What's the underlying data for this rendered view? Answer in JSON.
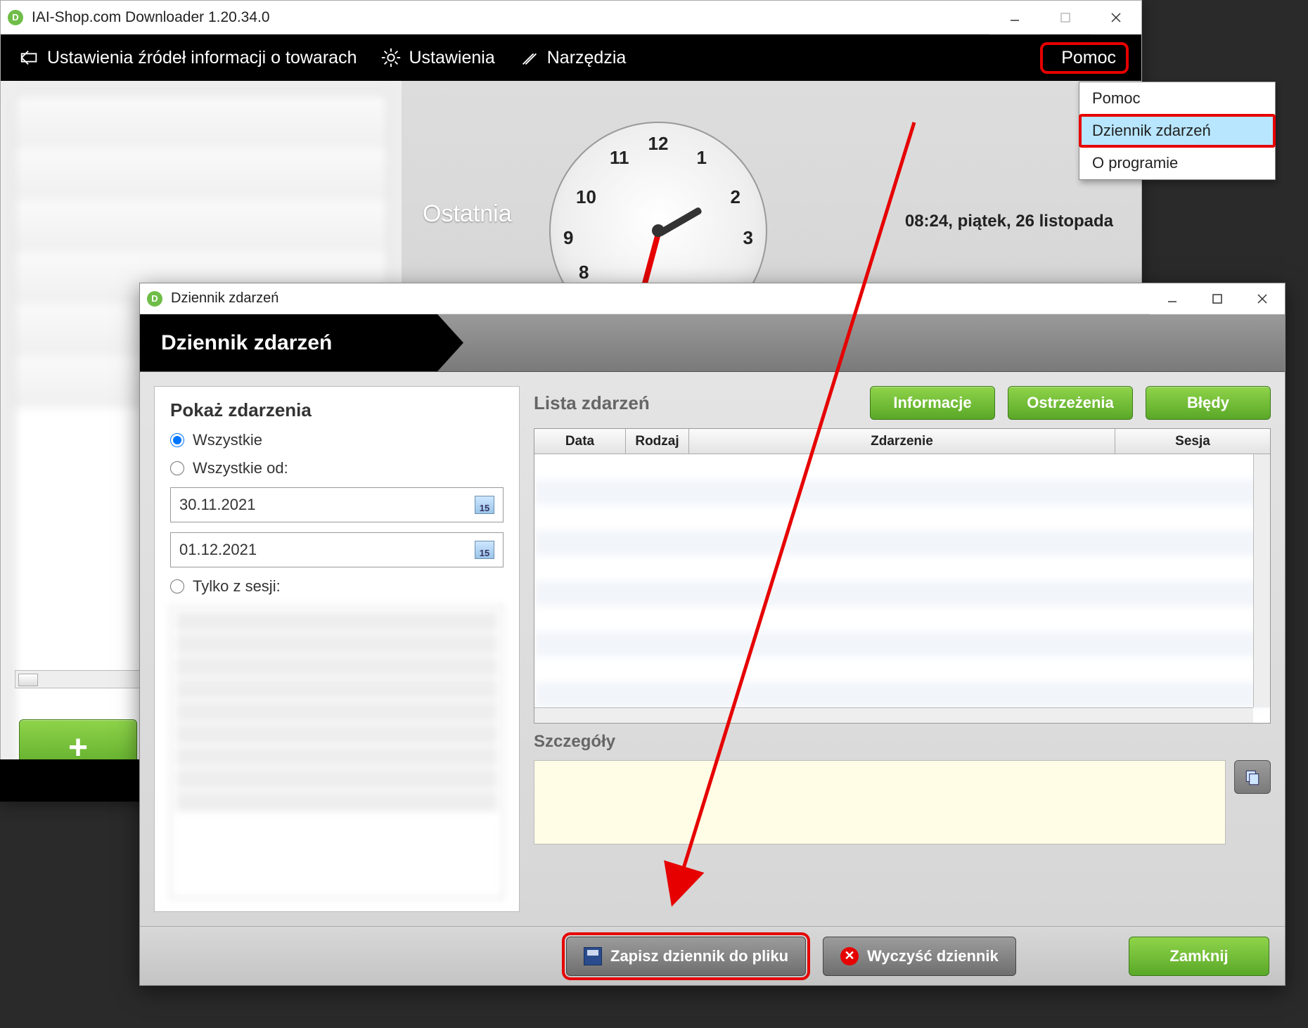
{
  "main": {
    "title": "IAI-Shop.com Downloader 1.20.34.0",
    "menu": {
      "sources": "Ustawienia źródeł informacji o towarach",
      "settings": "Ustawienia",
      "tools": "Narzędzia",
      "help": "Pomoc"
    },
    "help_dropdown": [
      "Pomoc",
      "Dziennik zdarzeń",
      "O programie"
    ],
    "highlighted_help_item_index": 1,
    "ostatnia_label": "Ostatnia",
    "datetime": "08:24, piątek, 26 listopada",
    "clock_numbers": {
      "n12": "12",
      "n11": "11",
      "n1": "1",
      "n10": "10",
      "n2": "2",
      "n9": "9",
      "n3": "3",
      "n8": "8"
    },
    "add_label": "+"
  },
  "log": {
    "window_title": "Dziennik zdarzeń",
    "ribbon_title": "Dziennik zdarzeń",
    "filter": {
      "heading": "Pokaż zdarzenia",
      "radio_all": "Wszystkie",
      "radio_from": "Wszystkie od:",
      "date_from": "30.11.2021",
      "date_to": "01.12.2021",
      "radio_session": "Tylko z sesji:",
      "cal_badge": "15"
    },
    "events": {
      "heading": "Lista zdarzeń",
      "pill_info": "Informacje",
      "pill_warn": "Ostrzeżenia",
      "pill_err": "Błędy",
      "cols": {
        "date": "Data",
        "kind": "Rodzaj",
        "event": "Zdarzenie",
        "session": "Sesja"
      }
    },
    "details_label": "Szczegóły",
    "footer": {
      "save": "Zapisz dziennik do pliku",
      "clear": "Wyczyść dziennik",
      "close": "Zamknij",
      "x_glyph": "✕"
    }
  }
}
